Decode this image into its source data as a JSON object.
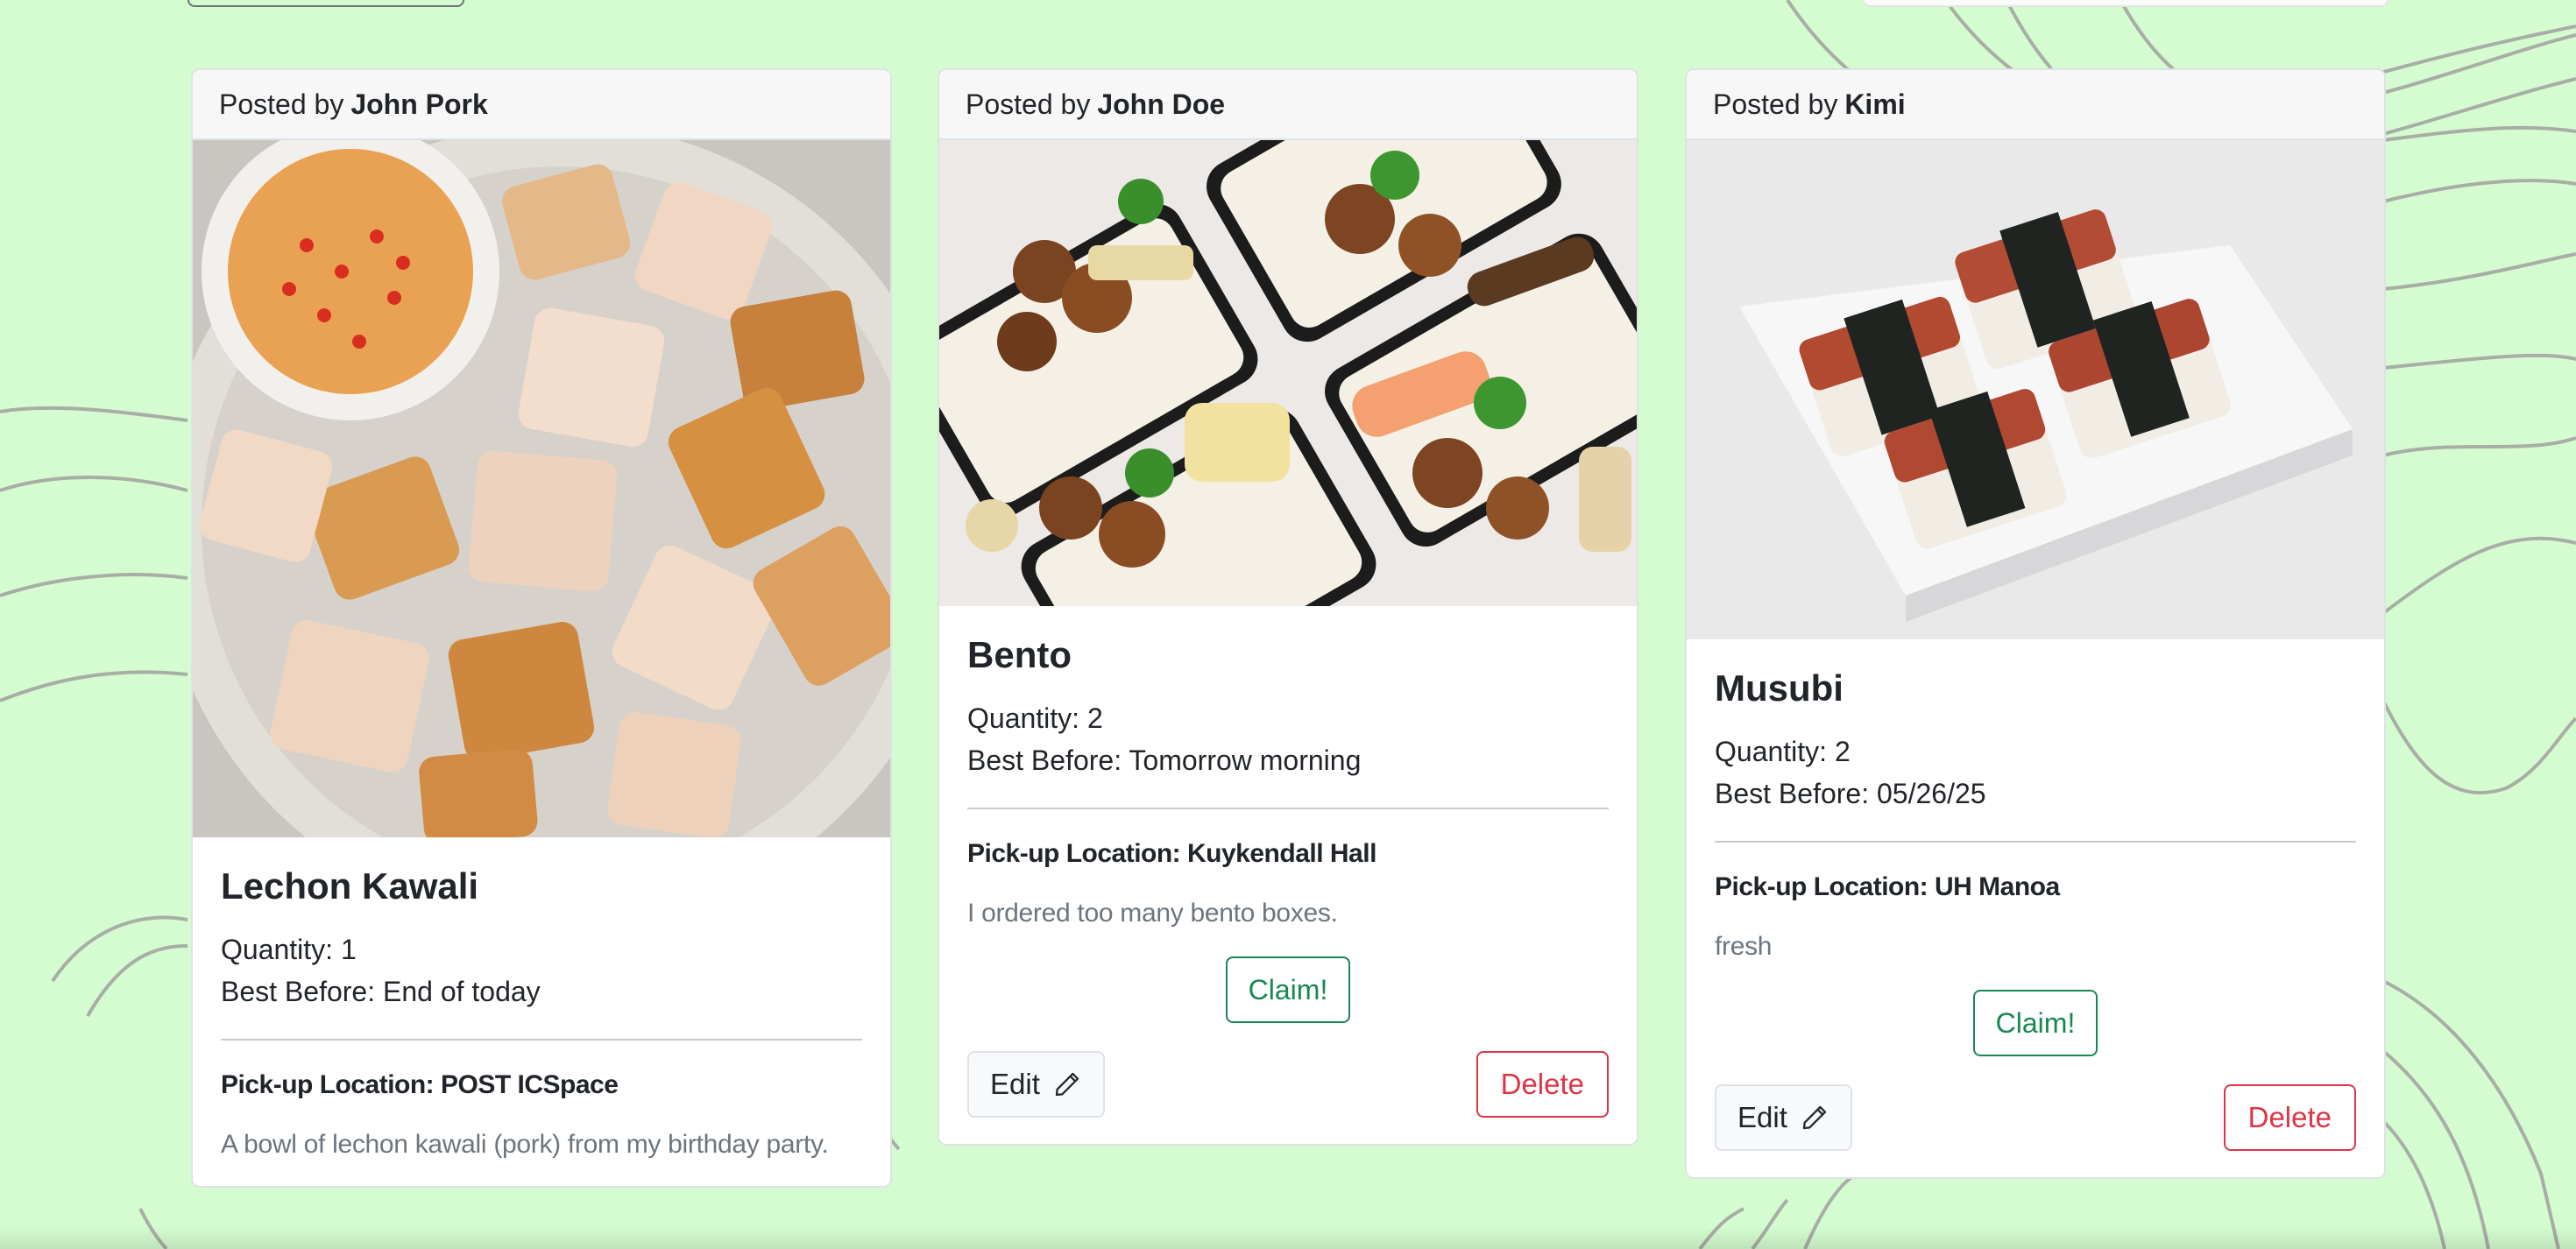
{
  "cards": [
    {
      "posted_prefix": "Posted by",
      "author": "John Pork",
      "image_alt": "plate of lechon kawali pork with dipping sauce",
      "title": "Lechon Kawali",
      "quantity": "Quantity: 1",
      "best_before": "Best Before: End of today",
      "pickup": "Pick-up Location: POST ICSpace",
      "description": "A bowl of lechon kawali (pork) from my birthday party."
    },
    {
      "posted_prefix": "Posted by",
      "author": "John Doe",
      "image_alt": "bento boxes with rice, chicken, fish and broccoli",
      "title": "Bento",
      "quantity": "Quantity: 2",
      "best_before": "Best Before: Tomorrow morning",
      "pickup": "Pick-up Location: Kuykendall Hall",
      "description": "I ordered too many bento boxes.",
      "claim_label": "Claim!",
      "edit_label": "Edit",
      "delete_label": "Delete"
    },
    {
      "posted_prefix": "Posted by",
      "author": "Kimi",
      "image_alt": "spam musubi on a white plate",
      "title": "Musubi",
      "quantity": "Quantity: 2",
      "best_before": "Best Before: 05/26/25",
      "pickup": "Pick-up Location: UH Manoa",
      "description": "fresh",
      "claim_label": "Claim!",
      "edit_label": "Edit",
      "delete_label": "Delete"
    }
  ],
  "colors": {
    "page_background": "#d5fcd0",
    "claim": "#198754",
    "delete": "#dc3545"
  }
}
